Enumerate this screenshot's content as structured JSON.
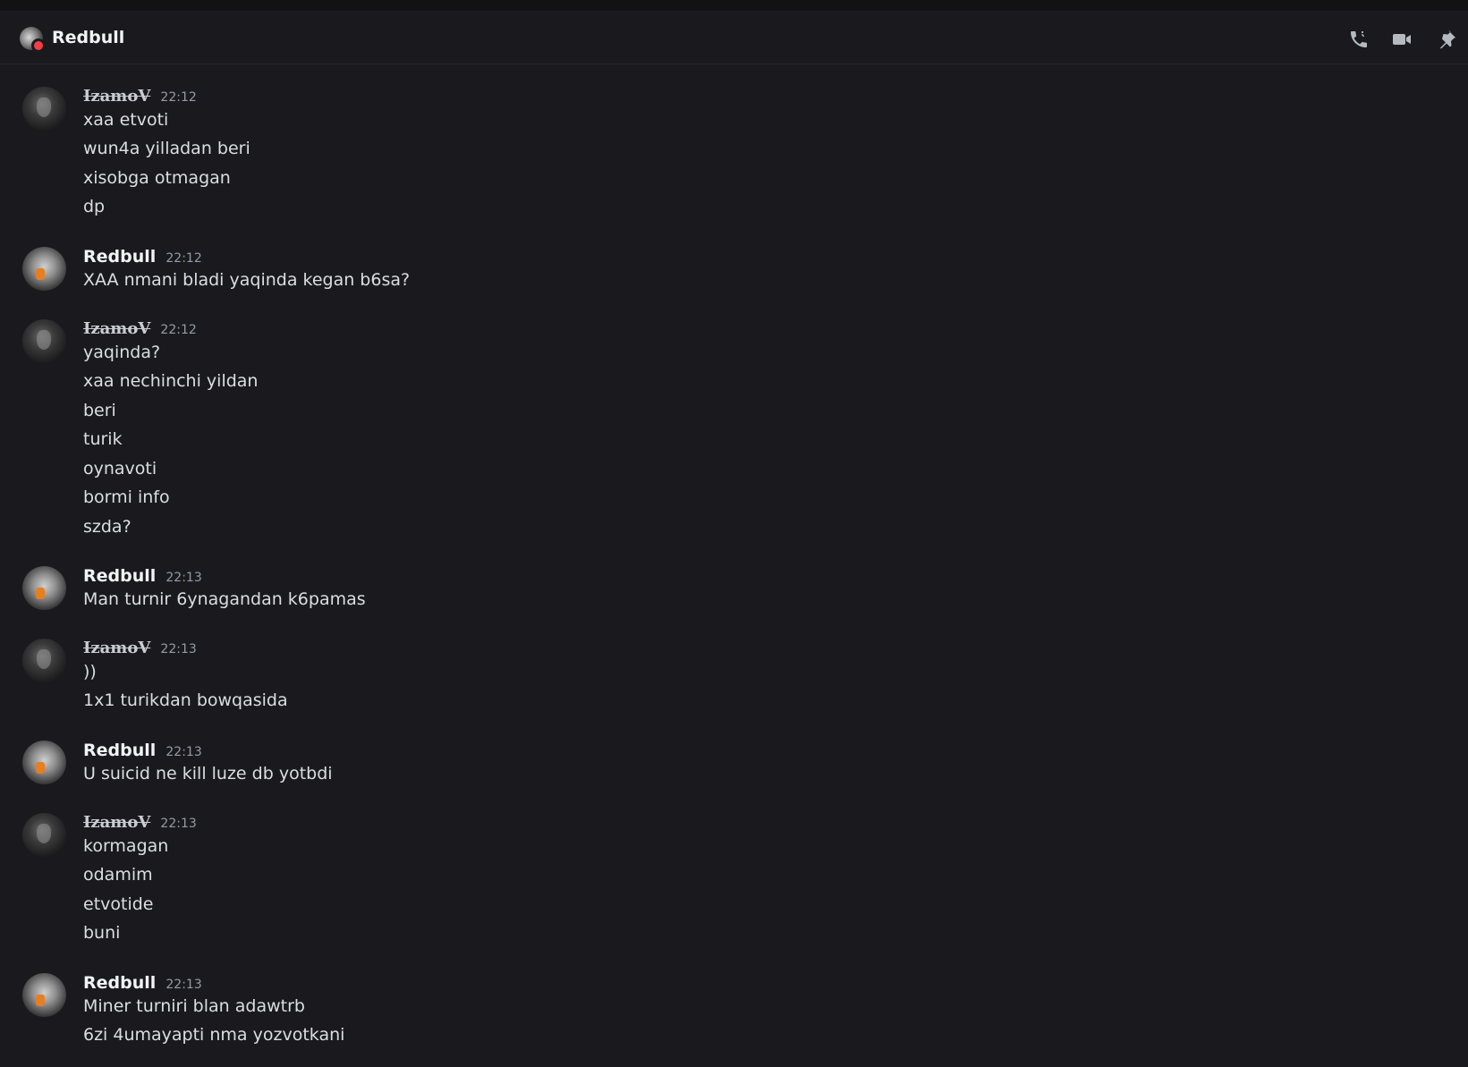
{
  "header": {
    "title": "Redbull",
    "icons": [
      "phone-call-icon",
      "video-call-icon",
      "pin-icon"
    ]
  },
  "messages": [
    {
      "author": "IzamoV",
      "time": "22:12",
      "lines": [
        "xaa etvoti",
        "wun4a yilladan beri",
        "xisobga otmagan",
        "dp"
      ]
    },
    {
      "author": "Redbull",
      "time": "22:12",
      "lines": [
        "XAA nmani bladi yaqinda kegan b6sa?"
      ]
    },
    {
      "author": "IzamoV",
      "time": "22:12",
      "lines": [
        "yaqinda?",
        "xaa nechinchi yildan",
        "beri",
        "turik",
        "oynavoti",
        "bormi info",
        "szda?"
      ]
    },
    {
      "author": "Redbull",
      "time": "22:13",
      "lines": [
        "Man turnir 6ynagandan k6pamas"
      ]
    },
    {
      "author": "IzamoV",
      "time": "22:13",
      "lines": [
        "))",
        "1x1 turikdan bowqasida"
      ]
    },
    {
      "author": "Redbull",
      "time": "22:13",
      "lines": [
        "U suicid ne kill luze db yotbdi"
      ]
    },
    {
      "author": "IzamoV",
      "time": "22:13",
      "lines": [
        "kormagan",
        "odamim",
        "etvotide",
        "buni"
      ]
    },
    {
      "author": "Redbull",
      "time": "22:13",
      "lines": [
        "Miner turniri blan adawtrb",
        "6zi 4umayapti nma yozvotkani"
      ]
    }
  ]
}
